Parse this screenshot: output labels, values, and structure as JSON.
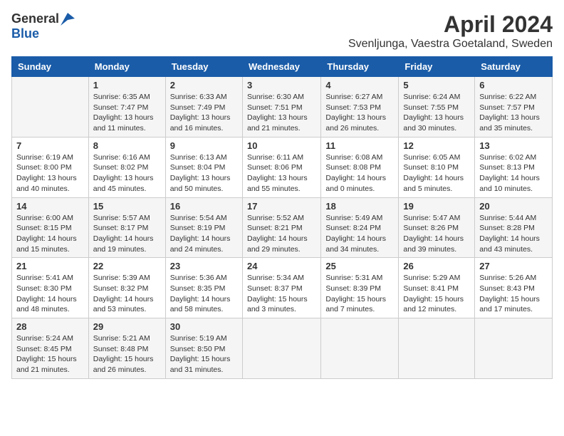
{
  "header": {
    "logo_general": "General",
    "logo_blue": "Blue",
    "title": "April 2024",
    "subtitle": "Svenljunga, Vaestra Goetaland, Sweden"
  },
  "columns": [
    "Sunday",
    "Monday",
    "Tuesday",
    "Wednesday",
    "Thursday",
    "Friday",
    "Saturday"
  ],
  "weeks": [
    [
      {
        "day": "",
        "info": ""
      },
      {
        "day": "1",
        "info": "Sunrise: 6:35 AM\nSunset: 7:47 PM\nDaylight: 13 hours\nand 11 minutes."
      },
      {
        "day": "2",
        "info": "Sunrise: 6:33 AM\nSunset: 7:49 PM\nDaylight: 13 hours\nand 16 minutes."
      },
      {
        "day": "3",
        "info": "Sunrise: 6:30 AM\nSunset: 7:51 PM\nDaylight: 13 hours\nand 21 minutes."
      },
      {
        "day": "4",
        "info": "Sunrise: 6:27 AM\nSunset: 7:53 PM\nDaylight: 13 hours\nand 26 minutes."
      },
      {
        "day": "5",
        "info": "Sunrise: 6:24 AM\nSunset: 7:55 PM\nDaylight: 13 hours\nand 30 minutes."
      },
      {
        "day": "6",
        "info": "Sunrise: 6:22 AM\nSunset: 7:57 PM\nDaylight: 13 hours\nand 35 minutes."
      }
    ],
    [
      {
        "day": "7",
        "info": "Sunrise: 6:19 AM\nSunset: 8:00 PM\nDaylight: 13 hours\nand 40 minutes."
      },
      {
        "day": "8",
        "info": "Sunrise: 6:16 AM\nSunset: 8:02 PM\nDaylight: 13 hours\nand 45 minutes."
      },
      {
        "day": "9",
        "info": "Sunrise: 6:13 AM\nSunset: 8:04 PM\nDaylight: 13 hours\nand 50 minutes."
      },
      {
        "day": "10",
        "info": "Sunrise: 6:11 AM\nSunset: 8:06 PM\nDaylight: 13 hours\nand 55 minutes."
      },
      {
        "day": "11",
        "info": "Sunrise: 6:08 AM\nSunset: 8:08 PM\nDaylight: 14 hours\nand 0 minutes."
      },
      {
        "day": "12",
        "info": "Sunrise: 6:05 AM\nSunset: 8:10 PM\nDaylight: 14 hours\nand 5 minutes."
      },
      {
        "day": "13",
        "info": "Sunrise: 6:02 AM\nSunset: 8:13 PM\nDaylight: 14 hours\nand 10 minutes."
      }
    ],
    [
      {
        "day": "14",
        "info": "Sunrise: 6:00 AM\nSunset: 8:15 PM\nDaylight: 14 hours\nand 15 minutes."
      },
      {
        "day": "15",
        "info": "Sunrise: 5:57 AM\nSunset: 8:17 PM\nDaylight: 14 hours\nand 19 minutes."
      },
      {
        "day": "16",
        "info": "Sunrise: 5:54 AM\nSunset: 8:19 PM\nDaylight: 14 hours\nand 24 minutes."
      },
      {
        "day": "17",
        "info": "Sunrise: 5:52 AM\nSunset: 8:21 PM\nDaylight: 14 hours\nand 29 minutes."
      },
      {
        "day": "18",
        "info": "Sunrise: 5:49 AM\nSunset: 8:24 PM\nDaylight: 14 hours\nand 34 minutes."
      },
      {
        "day": "19",
        "info": "Sunrise: 5:47 AM\nSunset: 8:26 PM\nDaylight: 14 hours\nand 39 minutes."
      },
      {
        "day": "20",
        "info": "Sunrise: 5:44 AM\nSunset: 8:28 PM\nDaylight: 14 hours\nand 43 minutes."
      }
    ],
    [
      {
        "day": "21",
        "info": "Sunrise: 5:41 AM\nSunset: 8:30 PM\nDaylight: 14 hours\nand 48 minutes."
      },
      {
        "day": "22",
        "info": "Sunrise: 5:39 AM\nSunset: 8:32 PM\nDaylight: 14 hours\nand 53 minutes."
      },
      {
        "day": "23",
        "info": "Sunrise: 5:36 AM\nSunset: 8:35 PM\nDaylight: 14 hours\nand 58 minutes."
      },
      {
        "day": "24",
        "info": "Sunrise: 5:34 AM\nSunset: 8:37 PM\nDaylight: 15 hours\nand 3 minutes."
      },
      {
        "day": "25",
        "info": "Sunrise: 5:31 AM\nSunset: 8:39 PM\nDaylight: 15 hours\nand 7 minutes."
      },
      {
        "day": "26",
        "info": "Sunrise: 5:29 AM\nSunset: 8:41 PM\nDaylight: 15 hours\nand 12 minutes."
      },
      {
        "day": "27",
        "info": "Sunrise: 5:26 AM\nSunset: 8:43 PM\nDaylight: 15 hours\nand 17 minutes."
      }
    ],
    [
      {
        "day": "28",
        "info": "Sunrise: 5:24 AM\nSunset: 8:45 PM\nDaylight: 15 hours\nand 21 minutes."
      },
      {
        "day": "29",
        "info": "Sunrise: 5:21 AM\nSunset: 8:48 PM\nDaylight: 15 hours\nand 26 minutes."
      },
      {
        "day": "30",
        "info": "Sunrise: 5:19 AM\nSunset: 8:50 PM\nDaylight: 15 hours\nand 31 minutes."
      },
      {
        "day": "",
        "info": ""
      },
      {
        "day": "",
        "info": ""
      },
      {
        "day": "",
        "info": ""
      },
      {
        "day": "",
        "info": ""
      }
    ]
  ]
}
